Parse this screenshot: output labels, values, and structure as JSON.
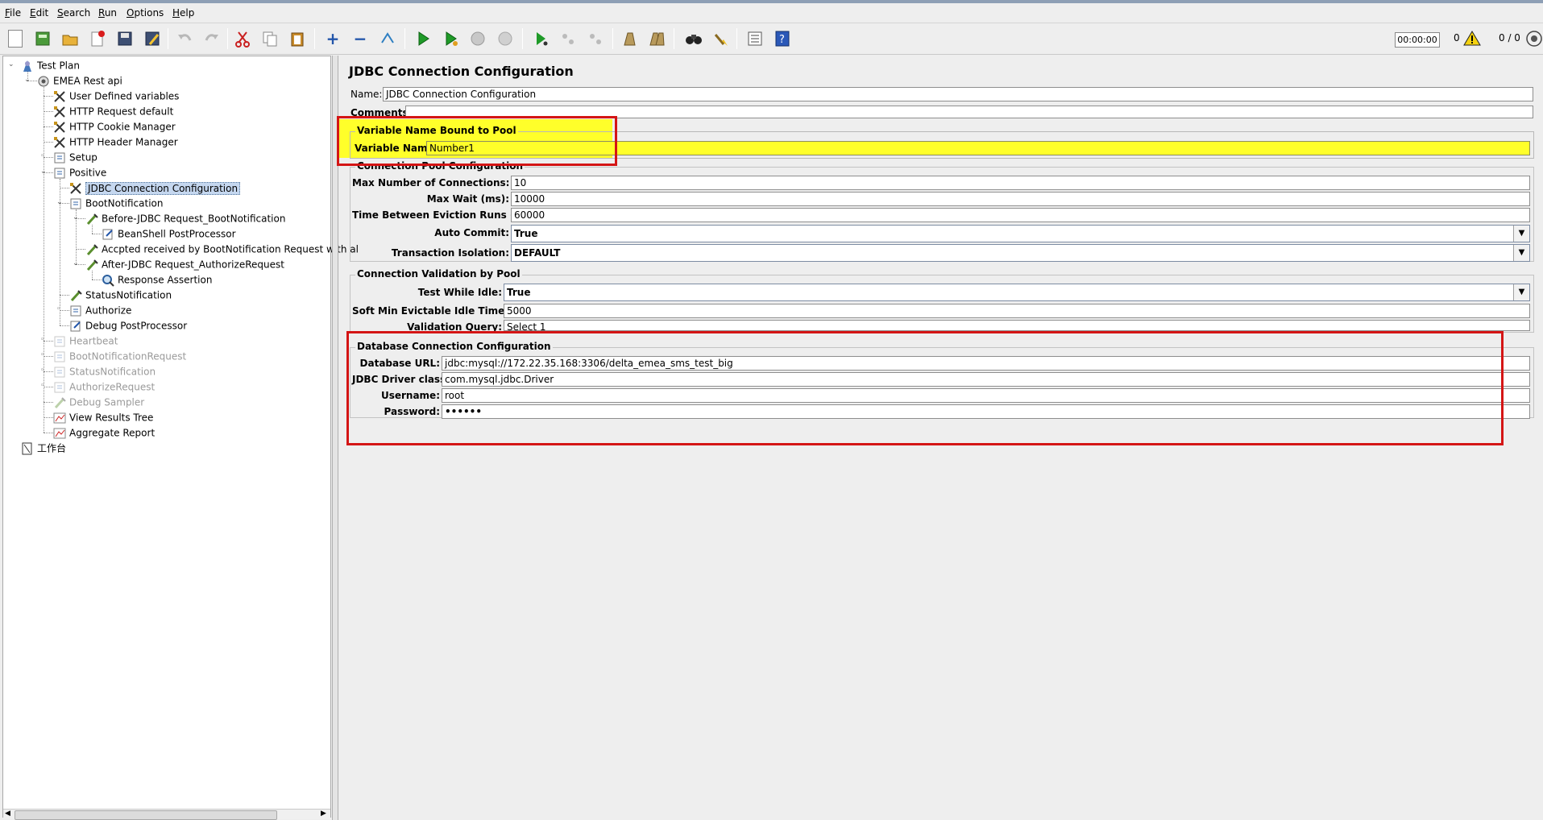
{
  "menu": [
    "File",
    "Edit",
    "Search",
    "Run",
    "Options",
    "Help"
  ],
  "toolbar": {
    "timer": "00:00:00",
    "warning_count": "0",
    "thread_count": "0 / 0",
    "icons": [
      "new-icon",
      "templates-icon",
      "open-icon",
      "close-icon",
      "save-icon",
      "save-as-icon",
      "undo-icon",
      "redo-icon",
      "cut-icon",
      "copy-icon",
      "paste-icon",
      "expand-icon",
      "collapse-icon",
      "toggle-icon",
      "start-icon",
      "start-no-pause-icon",
      "stop-icon",
      "shutdown-icon",
      "remote-start-icon",
      "remote-stop-icon",
      "remote-exit-icon",
      "clear-icon",
      "clear-all-icon",
      "search-icon",
      "reset-search-icon",
      "function-helper-icon",
      "help-icon"
    ]
  },
  "tree": [
    {
      "label": "Test Plan",
      "icon": "testplan-icon",
      "indent": 0,
      "disabled": false
    },
    {
      "label": "EMEA Rest api",
      "icon": "threadgroup-icon",
      "indent": 1,
      "disabled": false
    },
    {
      "label": "User Defined variables",
      "icon": "config-icon",
      "indent": 2,
      "disabled": false
    },
    {
      "label": "HTTP Request  default",
      "icon": "config-icon",
      "indent": 2,
      "disabled": false
    },
    {
      "label": "HTTP Cookie Manager",
      "icon": "config-icon",
      "indent": 2,
      "disabled": false
    },
    {
      "label": "HTTP Header Manager",
      "icon": "config-icon",
      "indent": 2,
      "disabled": false
    },
    {
      "label": "Setup",
      "icon": "controller-icon",
      "indent": 2,
      "disabled": false
    },
    {
      "label": "Positive",
      "icon": "controller-icon",
      "indent": 2,
      "disabled": false
    },
    {
      "label": "JDBC Connection Configuration",
      "icon": "config-icon",
      "indent": 3,
      "disabled": false,
      "selected": true
    },
    {
      "label": "BootNotification",
      "icon": "controller-icon",
      "indent": 3,
      "disabled": false
    },
    {
      "label": "Before-JDBC Request_BootNotification",
      "icon": "sampler-icon",
      "indent": 4,
      "disabled": false
    },
    {
      "label": "BeanShell PostProcessor",
      "icon": "postprocessor-icon",
      "indent": 5,
      "disabled": false
    },
    {
      "label": "Accpted received by BootNotification Request with al",
      "icon": "sampler-icon",
      "indent": 4,
      "disabled": false
    },
    {
      "label": "After-JDBC Request_AuthorizeRequest",
      "icon": "sampler-icon",
      "indent": 4,
      "disabled": false
    },
    {
      "label": "Response Assertion",
      "icon": "assertion-icon",
      "indent": 5,
      "disabled": false
    },
    {
      "label": "StatusNotification",
      "icon": "sampler-icon",
      "indent": 3,
      "disabled": false
    },
    {
      "label": "Authorize",
      "icon": "controller-icon",
      "indent": 3,
      "disabled": false
    },
    {
      "label": "Debug PostProcessor",
      "icon": "postprocessor-icon",
      "indent": 3,
      "disabled": false
    },
    {
      "label": "Heartbeat",
      "icon": "controller-icon",
      "indent": 2,
      "disabled": true
    },
    {
      "label": "BootNotificationRequest",
      "icon": "controller-icon",
      "indent": 2,
      "disabled": true
    },
    {
      "label": "StatusNotification",
      "icon": "controller-icon",
      "indent": 2,
      "disabled": true
    },
    {
      "label": "AuthorizeRequest",
      "icon": "controller-icon",
      "indent": 2,
      "disabled": true
    },
    {
      "label": "Debug Sampler",
      "icon": "sampler-icon",
      "indent": 2,
      "disabled": true
    },
    {
      "label": "View Results Tree",
      "icon": "listener-icon",
      "indent": 2,
      "disabled": false
    },
    {
      "label": "Aggregate Report",
      "icon": "listener-icon",
      "indent": 2,
      "disabled": false
    },
    {
      "label": "工作台",
      "icon": "workbench-icon",
      "indent": 0,
      "disabled": false
    }
  ],
  "panel": {
    "title": "JDBC Connection Configuration",
    "name_label": "Name:",
    "name_value": "JDBC Connection Configuration",
    "comments_label": "Comments:",
    "pool_var": {
      "title": "Variable Name Bound to Pool",
      "label": "Variable Name:",
      "value": "Number1"
    },
    "pool_config": {
      "title": "Connection Pool Configuration",
      "max_conn_label": "Max Number of Connections:",
      "max_conn_value": "10",
      "max_wait_label": "Max Wait (ms):",
      "max_wait_value": "10000",
      "eviction_label": "Time Between Eviction Runs (ms):",
      "eviction_value": "60000",
      "auto_commit_label": "Auto Commit:",
      "auto_commit_value": "True",
      "isolation_label": "Transaction Isolation:",
      "isolation_value": "DEFAULT"
    },
    "validation": {
      "title": "Connection Validation by Pool",
      "test_idle_label": "Test While Idle:",
      "test_idle_value": "True",
      "soft_min_label": "Soft Min Evictable Idle Time(ms):",
      "soft_min_value": "5000",
      "query_label": "Validation Query:",
      "query_value": "Select 1"
    },
    "db": {
      "title": "Database Connection Configuration",
      "url_label": "Database URL:",
      "url_value": "jdbc:mysql://172.22.35.168:3306/delta_emea_sms_test_big",
      "driver_label": "JDBC Driver class:",
      "driver_value": "com.mysql.jdbc.Driver",
      "user_label": "Username:",
      "user_value": "root",
      "pass_label": "Password:",
      "pass_value": "••••••"
    }
  },
  "colors": {
    "highlight_yellow": "#ffff2a",
    "annotation_red": "#d41515",
    "selection_blue": "#c5d7ef"
  }
}
